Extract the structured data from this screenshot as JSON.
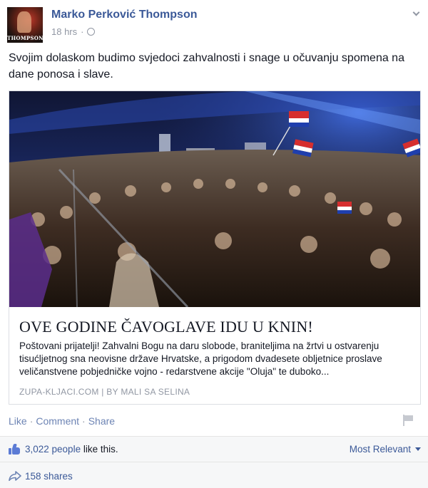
{
  "post": {
    "author": "Marko Perković Thompson",
    "time": "18 hrs",
    "separator": "·",
    "avatar_text": "THOMPSON",
    "message": "Svojim dolaskom budimo svjedoci zahvalnosti i snage u očuvanju spomena na dane ponosa i slave."
  },
  "link_card": {
    "title": "OVE GODINE ČAVOGLAVE IDU U KNIN!",
    "description": "Poštovani prijatelji! Zahvalni Bogu na daru slobode, braniteljima na žrtvi u ostvarenju tisućljetnog sna neovisne države Hrvatske, a prigodom dvadesete obljetnice proslave veličanstvene pobjedničke vojno - redarstvene akcije \"Oluja\" te duboko...",
    "source": "ZUPA-KLJACI.COM | BY MALI SA SELINA",
    "image_icon": "concert-crowd-photo"
  },
  "actions": {
    "like": "Like",
    "comment": "Comment",
    "share": "Share",
    "dot": "·"
  },
  "footer": {
    "likes_count": "3,022 people",
    "likes_suffix": " like this.",
    "sort_label": "Most Relevant",
    "shares": "158 shares"
  },
  "colors": {
    "link": "#3b5998",
    "muted": "#9197a3",
    "action": "#6d84b4",
    "footer_bg": "#f6f7f8"
  }
}
